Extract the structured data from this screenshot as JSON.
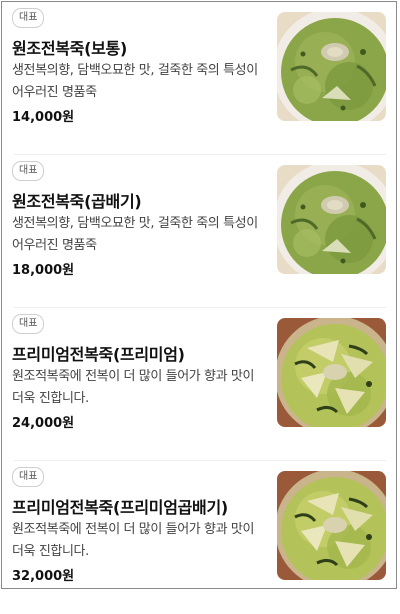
{
  "menu": {
    "items": [
      {
        "badge": "대표",
        "name": "원조전복죽(보통)",
        "description": "생전복의향, 담백오묘한 맛, 걸죽한 죽의 특성이 어우러진 명품죽",
        "price": "14,000원",
        "image_icon": "abalone-porridge-photo"
      },
      {
        "badge": "대표",
        "name": "원조전복죽(곱배기)",
        "description": "생전복의향, 담백오묘한 맛, 걸죽한 죽의 특성이 어우러진 명품죽",
        "price": "18,000원",
        "image_icon": "abalone-porridge-photo"
      },
      {
        "badge": "대표",
        "name": "프리미엄전복죽(프리미엄)",
        "description": "원조적복죽에 전복이 더 많이 들어가 향과 맛이 더욱 진합니다.",
        "price": "24,000원",
        "image_icon": "premium-abalone-porridge-photo"
      },
      {
        "badge": "대표",
        "name": "프리미엄전복죽(프리미엄곱배기)",
        "description": "원조적복죽에 전복이 더 많이 들어가 향과 맛이 더욱 진합니다.",
        "price": "32,000원",
        "image_icon": "premium-abalone-porridge-photo"
      }
    ]
  }
}
